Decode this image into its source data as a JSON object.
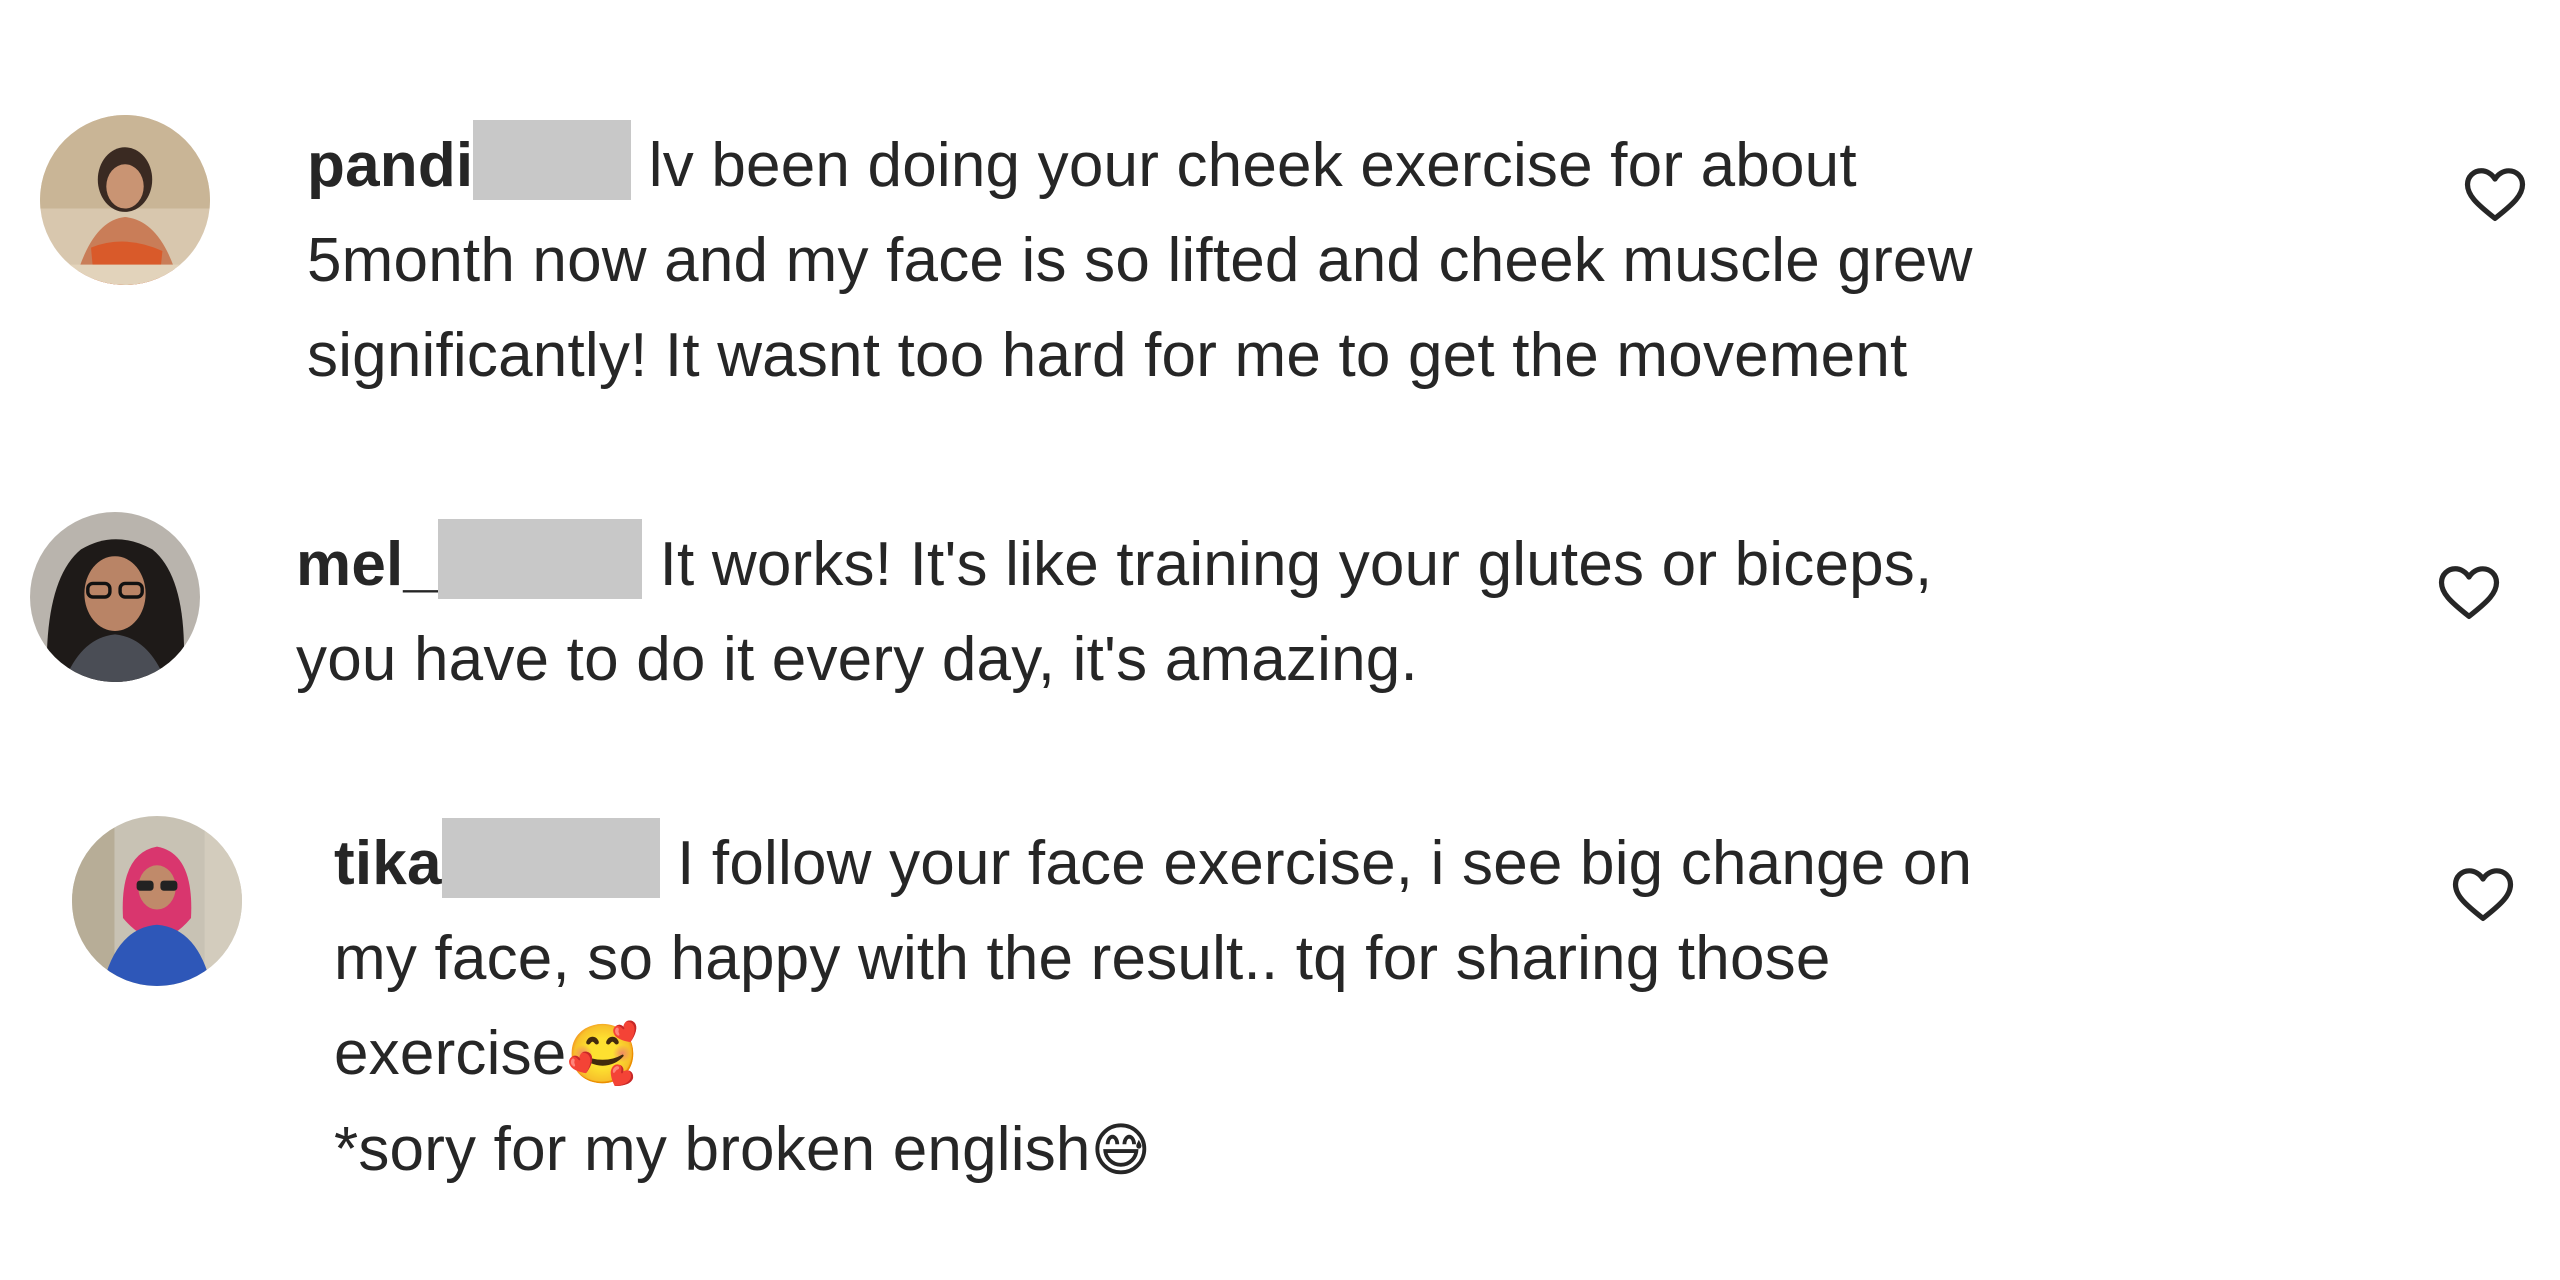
{
  "comments": [
    {
      "username": "pandi",
      "lines": [
        "lv been doing your cheek exercise for about",
        "5month now and my face is so lifted and cheek muscle grew",
        "significantly! It wasnt too hard for me to get the movement"
      ],
      "avatar_icon": "avatar-photo-1",
      "like_icon": "heart-outline-icon"
    },
    {
      "username": "mel_",
      "lines": [
        "It works! It's like training your glutes or biceps,",
        "you have to do it every day, it's amazing."
      ],
      "avatar_icon": "avatar-photo-2",
      "like_icon": "heart-outline-icon"
    },
    {
      "username": "tika",
      "lines": [
        "I follow your face exercise, i see big change on",
        "my face, so happy with the result.. tq for sharing those",
        "exercise",
        "*sory for my broken english"
      ],
      "emojis": [
        "🥰",
        "😅"
      ],
      "avatar_icon": "avatar-photo-3",
      "like_icon": "heart-outline-icon"
    }
  ],
  "colors": {
    "text": "#262626",
    "redaction": "#c8c8c8",
    "heart_stroke": "#262626"
  }
}
